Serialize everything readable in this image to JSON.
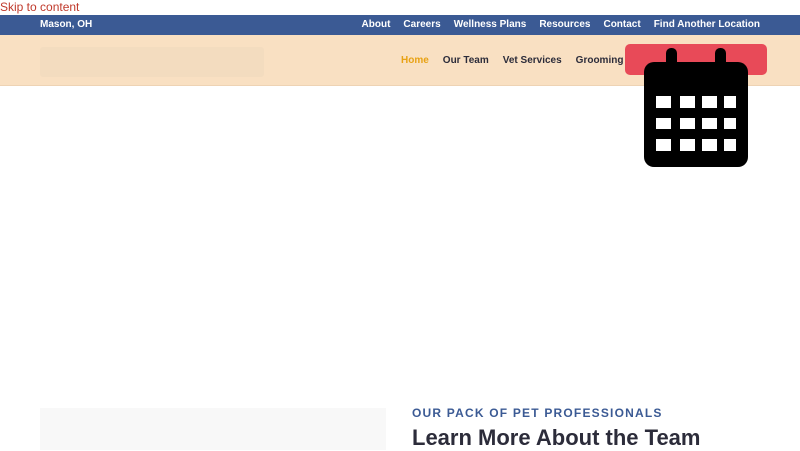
{
  "skip_link": "Skip to content",
  "top_bar": {
    "location": "Mason, OH",
    "nav": [
      {
        "label": "About"
      },
      {
        "label": "Careers"
      },
      {
        "label": "Wellness Plans"
      },
      {
        "label": "Resources"
      },
      {
        "label": "Contact"
      },
      {
        "label": "Find Another Location"
      }
    ]
  },
  "main_nav": {
    "items": [
      {
        "label": "Home",
        "active": true
      },
      {
        "label": "Our Team"
      },
      {
        "label": "Vet Services"
      },
      {
        "label": "Grooming"
      }
    ],
    "cta_icon": "calendar-icon"
  },
  "team_section": {
    "eyebrow": "OUR PACK OF PET PROFESSIONALS",
    "title": "Learn More About the Team"
  },
  "colors": {
    "top_bar": "#3b5a94",
    "header": "#f9e0c2",
    "active_nav": "#e8a214",
    "cta": "#e84a58",
    "link": "#c0392b"
  }
}
